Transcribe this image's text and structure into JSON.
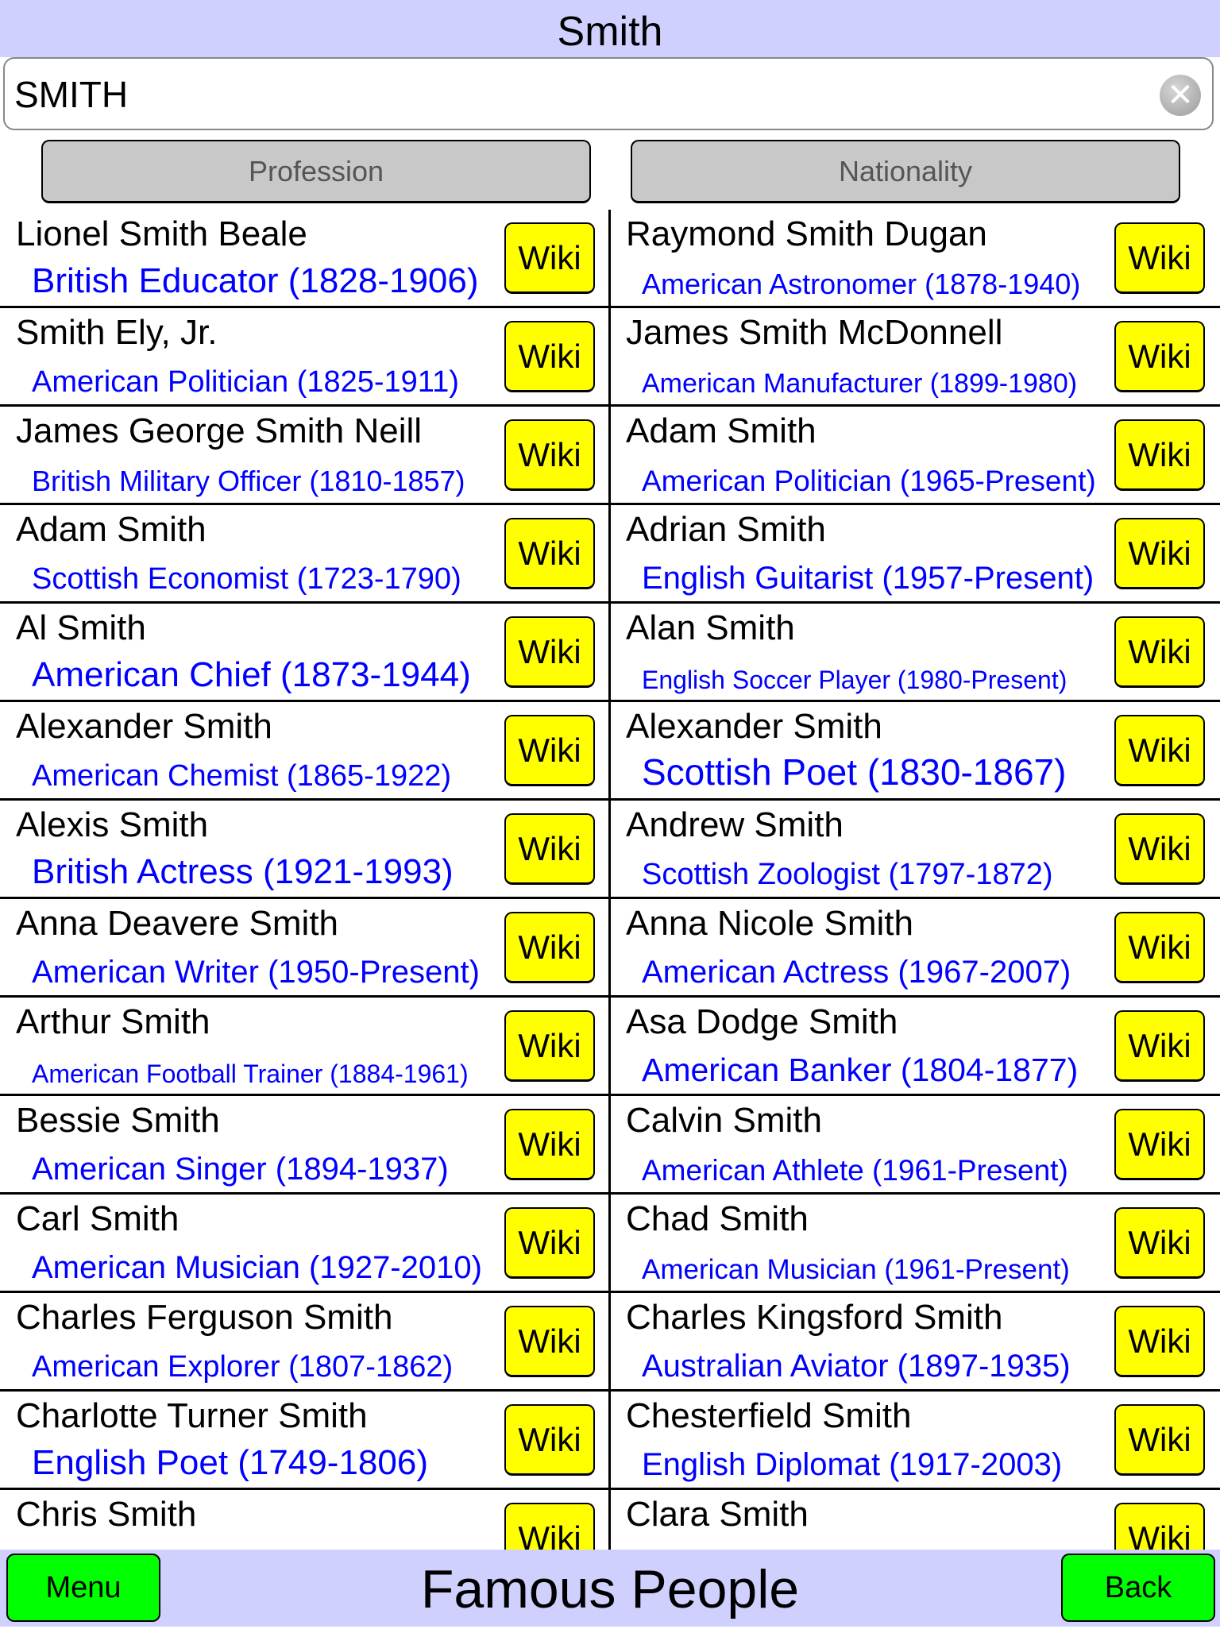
{
  "header": {
    "title": "Smith"
  },
  "search": {
    "value": "SMITH",
    "clear_icon": "clear-circle-x-icon"
  },
  "sort_buttons": {
    "profession": "Profession",
    "nationality": "Nationality"
  },
  "wiki_label": "Wiki",
  "colors": {
    "bar": "#d0d0ff",
    "wiki": "#ffff00",
    "nav_button": "#00ff00",
    "description": "#0000ff",
    "sort_button": "#c8c8c8"
  },
  "left_column": [
    {
      "name": "Lionel Smith Beale",
      "desc": "British Educator (1828-1906)"
    },
    {
      "name": "Smith Ely, Jr.",
      "desc": "American Politician (1825-1911)"
    },
    {
      "name": "James George Smith Neill",
      "desc": "British Military Officer (1810-1857)"
    },
    {
      "name": "Adam Smith",
      "desc": "Scottish Economist (1723-1790)"
    },
    {
      "name": "Al Smith",
      "desc": "American Chief (1873-1944)"
    },
    {
      "name": "Alexander Smith",
      "desc": "American Chemist (1865-1922)"
    },
    {
      "name": "Alexis Smith",
      "desc": "British Actress (1921-1993)"
    },
    {
      "name": "Anna Deavere Smith",
      "desc": "American Writer (1950-Present)"
    },
    {
      "name": "Arthur Smith",
      "desc": "American Football Trainer (1884-1961)"
    },
    {
      "name": "Bessie Smith",
      "desc": "American Singer (1894-1937)"
    },
    {
      "name": "Carl Smith",
      "desc": "American Musician (1927-2010)"
    },
    {
      "name": "Charles Ferguson Smith",
      "desc": "American Explorer (1807-1862)"
    },
    {
      "name": "Charlotte Turner Smith",
      "desc": "English Poet (1749-1806)"
    },
    {
      "name": "Chris Smith",
      "desc": ""
    }
  ],
  "right_column": [
    {
      "name": "Raymond Smith Dugan",
      "desc": "American Astronomer (1878-1940)"
    },
    {
      "name": "James Smith McDonnell",
      "desc": "American Manufacturer (1899-1980)"
    },
    {
      "name": "Adam Smith",
      "desc": "American Politician (1965-Present)"
    },
    {
      "name": "Adrian Smith",
      "desc": "English Guitarist (1957-Present)"
    },
    {
      "name": "Alan Smith",
      "desc": "English Soccer Player (1980-Present)"
    },
    {
      "name": "Alexander Smith",
      "desc": "Scottish Poet (1830-1867)"
    },
    {
      "name": "Andrew Smith",
      "desc": "Scottish Zoologist (1797-1872)"
    },
    {
      "name": "Anna Nicole Smith",
      "desc": "American Actress (1967-2007)"
    },
    {
      "name": "Asa Dodge Smith",
      "desc": "American Banker (1804-1877)"
    },
    {
      "name": "Calvin Smith",
      "desc": "American Athlete (1961-Present)"
    },
    {
      "name": "Chad Smith",
      "desc": "American Musician (1961-Present)"
    },
    {
      "name": "Charles Kingsford Smith",
      "desc": "Australian Aviator (1897-1935)"
    },
    {
      "name": "Chesterfield Smith",
      "desc": "English Diplomat (1917-2003)"
    },
    {
      "name": "Clara Smith",
      "desc": ""
    }
  ],
  "footer": {
    "title": "Famous People",
    "menu": "Menu",
    "back": "Back"
  }
}
